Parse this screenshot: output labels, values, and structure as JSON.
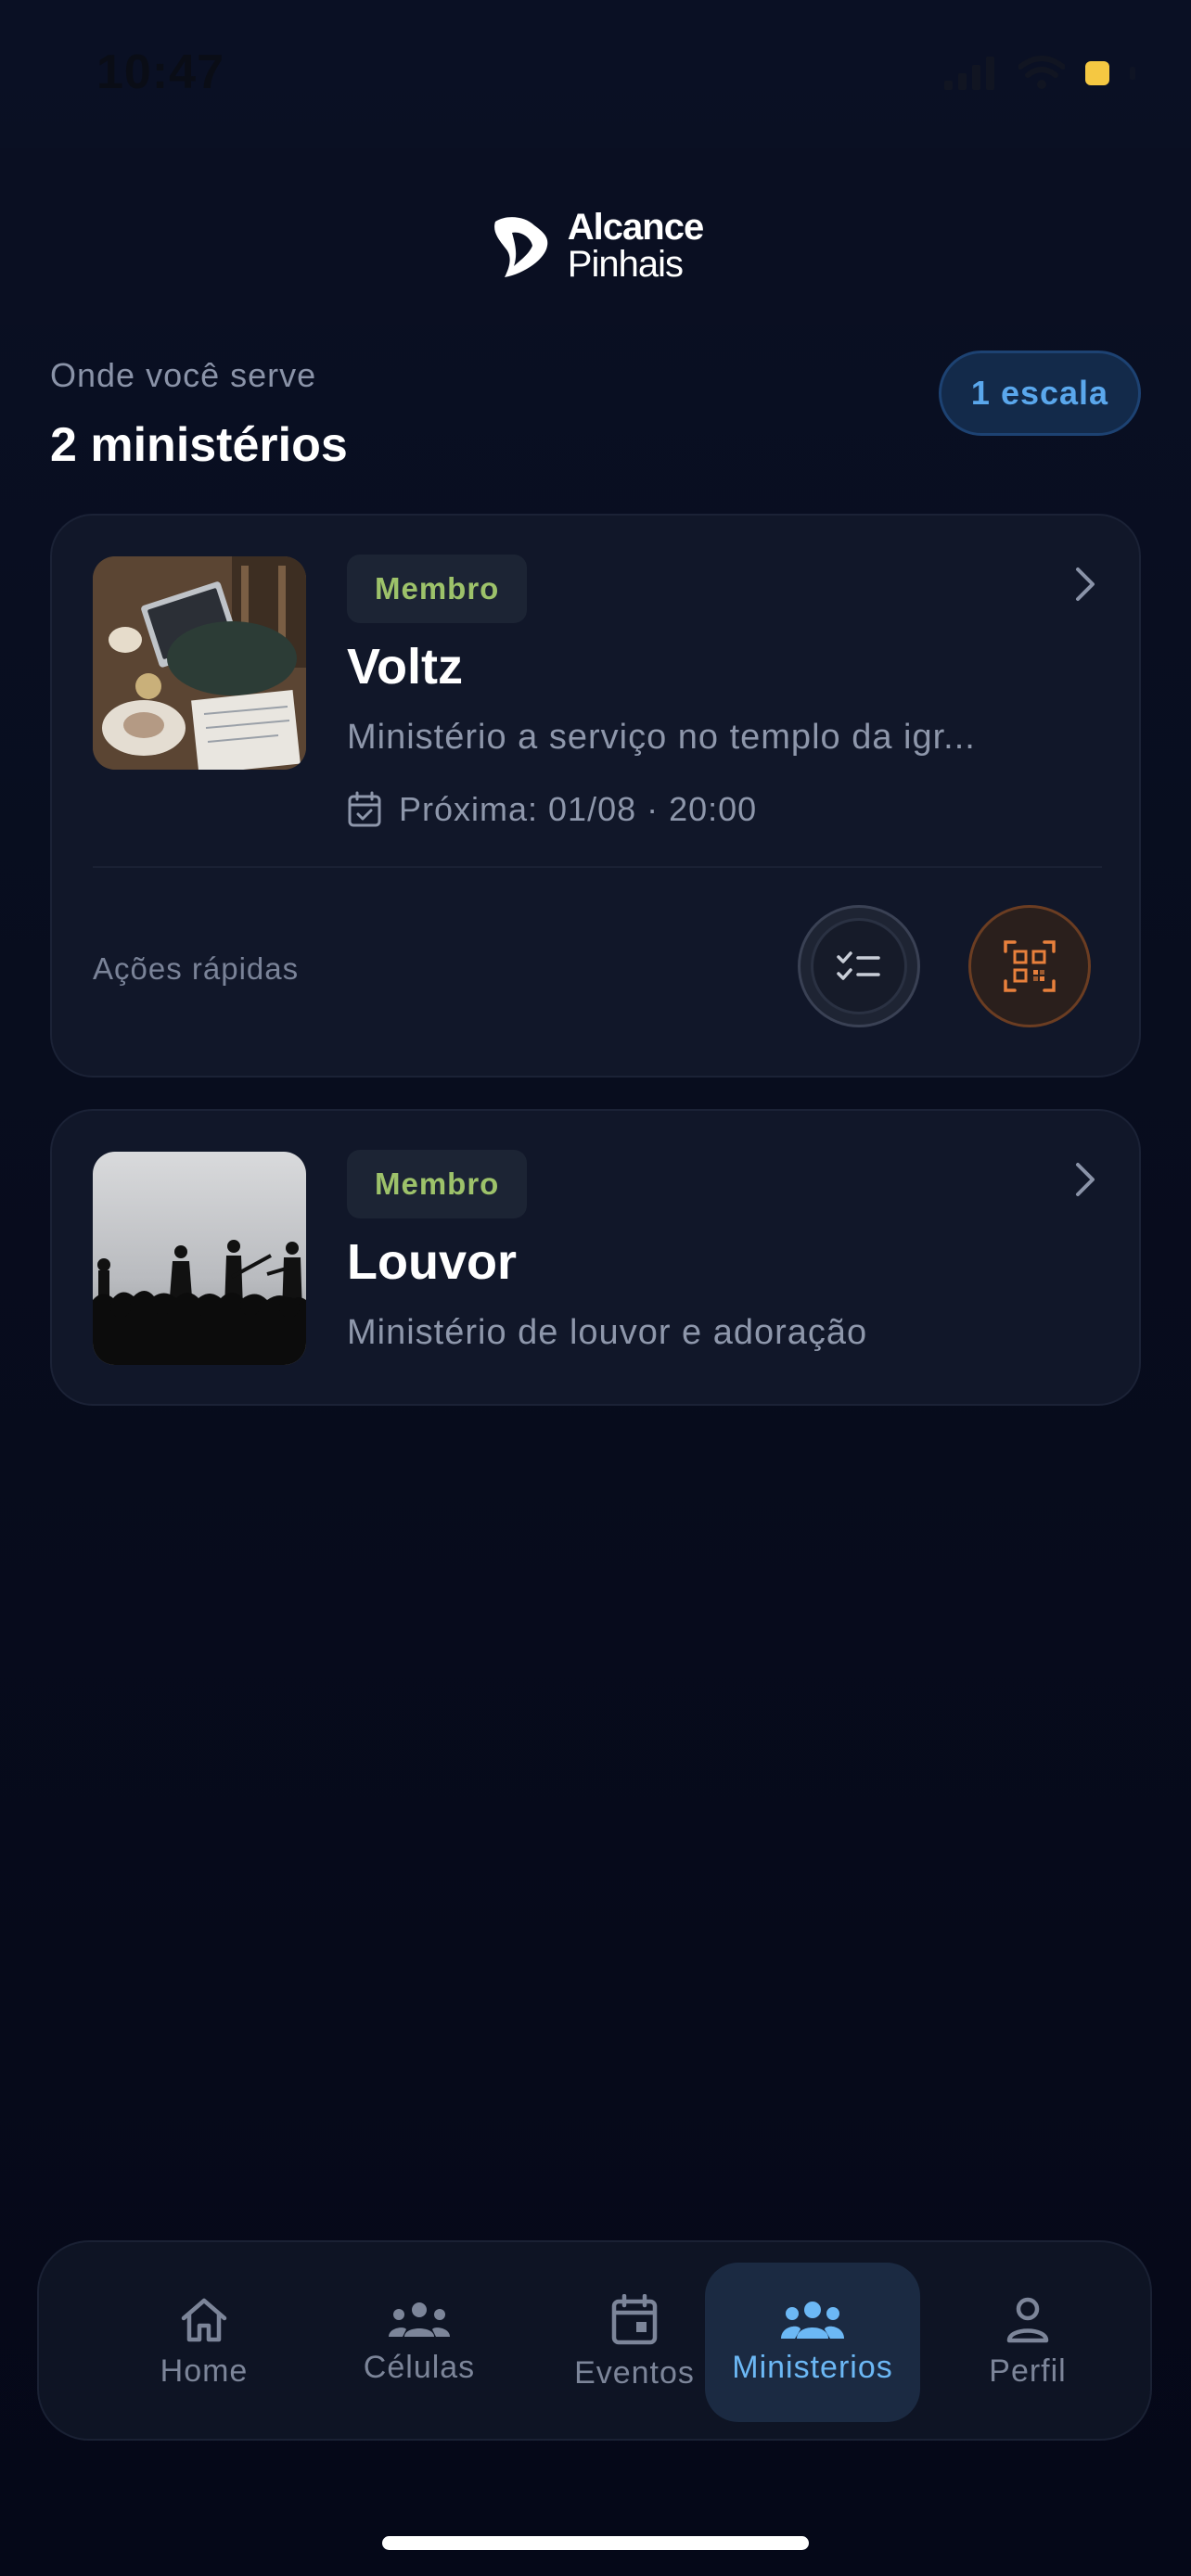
{
  "status_bar": {
    "time": "10:47"
  },
  "header": {
    "logo_line1": "Alcance",
    "logo_line2": "Pinhais"
  },
  "section": {
    "subtitle": "Onde você serve",
    "title": "2 ministérios",
    "escala_pill": "1 escala"
  },
  "ministries": [
    {
      "role": "Membro",
      "name": "Voltz",
      "description": "Ministério a serviço no templo da igr...",
      "next": "Próxima: 01/08 · 20:00",
      "quick_actions_label": "Ações rápidas"
    },
    {
      "role": "Membro",
      "name": "Louvor",
      "description": "Ministério de louvor e adoração"
    }
  ],
  "nav": {
    "items": [
      {
        "label": "Home",
        "icon": "home-icon"
      },
      {
        "label": "Células",
        "icon": "group-icon"
      },
      {
        "label": "Eventos",
        "icon": "calendar-icon"
      },
      {
        "label": "Ministerios",
        "icon": "people-icon",
        "active": true
      },
      {
        "label": "Perfil",
        "icon": "person-icon"
      }
    ]
  },
  "colors": {
    "background": "#060a18",
    "card": "#111729",
    "accent_blue": "#6cb8f5",
    "badge_green": "#9dc26a",
    "qr_orange": "#e8803c"
  }
}
